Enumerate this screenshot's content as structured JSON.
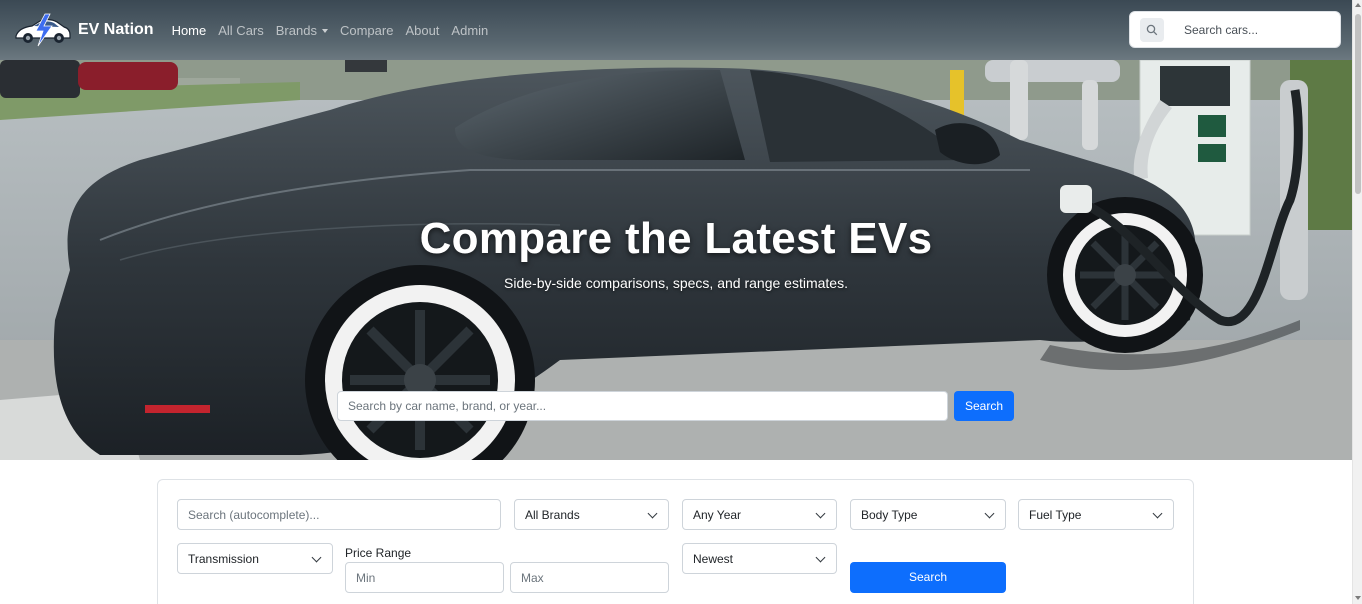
{
  "navbar": {
    "brand": "EV Nation",
    "links": [
      {
        "label": "Home",
        "active": true
      },
      {
        "label": "All Cars",
        "active": false
      },
      {
        "label": "Brands",
        "active": false,
        "dropdown": true
      },
      {
        "label": "Compare",
        "active": false
      },
      {
        "label": "About",
        "active": false
      },
      {
        "label": "Admin",
        "active": false
      }
    ],
    "search_placeholder": "Search cars..."
  },
  "hero": {
    "title": "Compare the Latest EVs",
    "subtitle": "Side-by-side comparisons, specs, and range estimates.",
    "search_placeholder": "Search by car name, brand, or year...",
    "search_button": "Search"
  },
  "filters": {
    "autocomplete_placeholder": "Search (autocomplete)...",
    "brand": "All Brands",
    "year": "Any Year",
    "body_type": "Body Type",
    "fuel_type": "Fuel Type",
    "transmission": "Transmission",
    "price_label": "Price Range",
    "price_min_placeholder": "Min",
    "price_max_placeholder": "Max",
    "sort": "Newest",
    "search_button": "Search"
  },
  "colors": {
    "primary": "#0d6efd",
    "navbar": "#4a5761"
  }
}
